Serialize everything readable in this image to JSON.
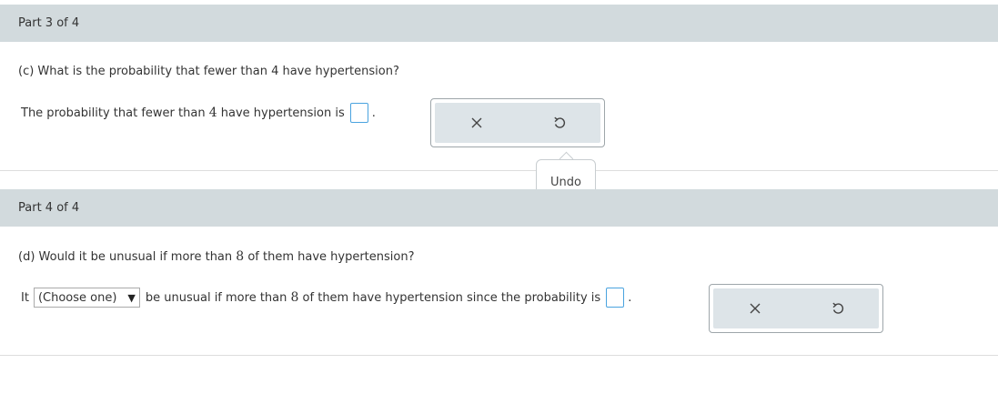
{
  "part3": {
    "header": "Part 3 of 4",
    "question": "(c) What is the probability that fewer than 4 have hypertension?",
    "answer_prefix": "The probability that fewer than ",
    "answer_number": "4",
    "answer_suffix": " have hypertension is",
    "period": ".",
    "tooltip": "Undo"
  },
  "part4": {
    "header": "Part 4 of 4",
    "question_prefix": "(d) Would it be unusual if more than ",
    "question_number": "8",
    "question_suffix": " of them have hypertension?",
    "answer_start": "It",
    "select_value": "(Choose one)",
    "answer_mid1": "be unusual if more than ",
    "answer_number": "8",
    "answer_mid2": " of them have hypertension since the probability is",
    "period": "."
  },
  "icons": {
    "clear": "close-icon",
    "undo": "undo-icon"
  },
  "colors": {
    "header_bg": "#d2dadd",
    "input_border": "#4aa3df",
    "tool_bg": "#dde4e8"
  }
}
